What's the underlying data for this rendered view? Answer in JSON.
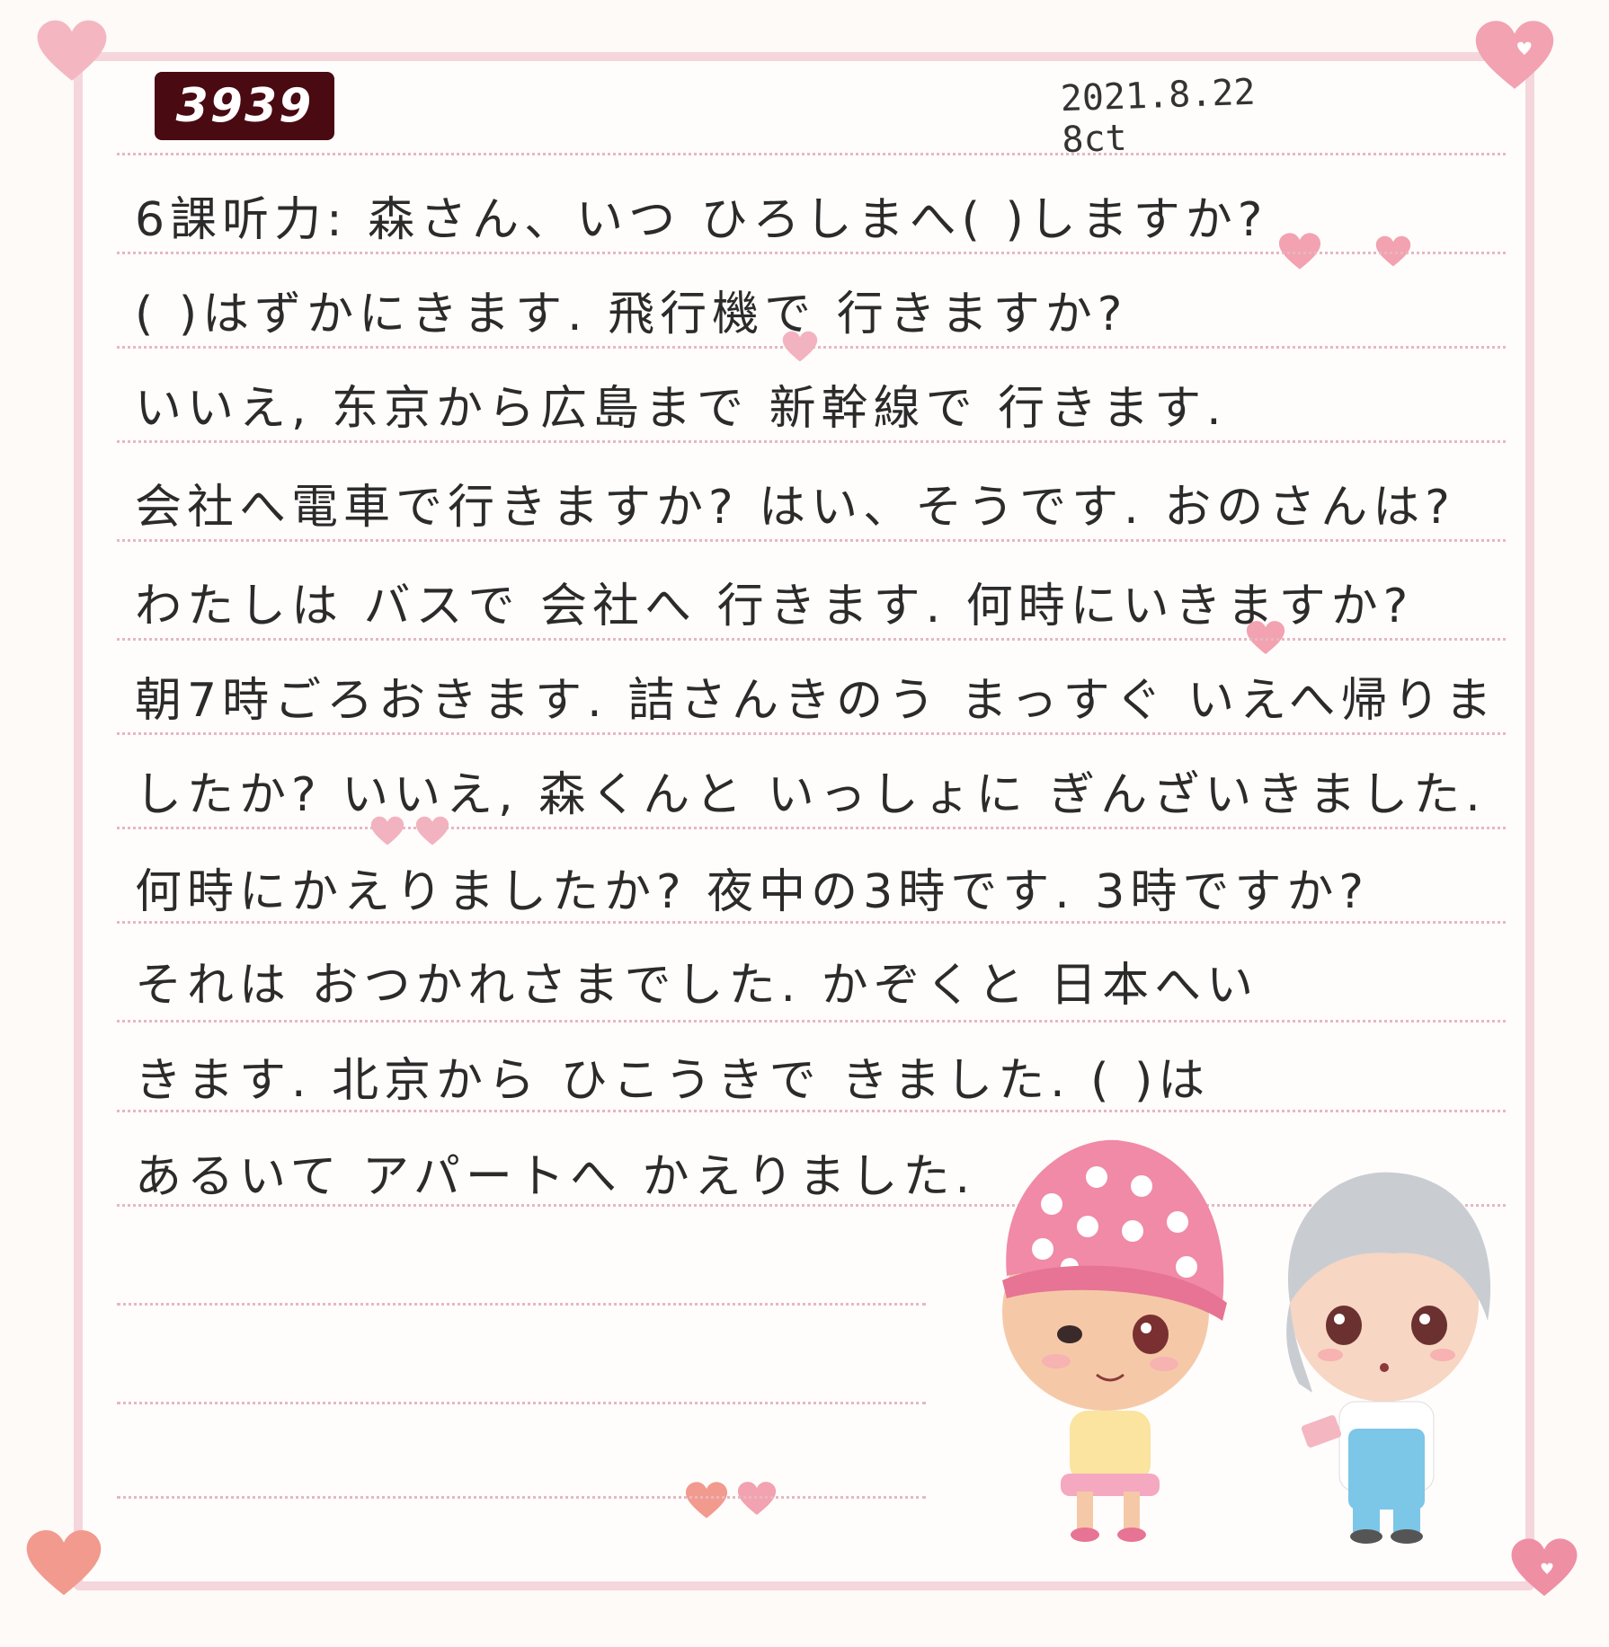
{
  "notebook": {
    "entry_number": "3939",
    "date": "2021.8.22 8ct"
  },
  "lines": [
    "6課听力: 森さん、いつ ひろしまへ(   )しますか?",
    "(   )はずかにきます. 飛行機で 行きますか?",
    "いいえ, 东京から広島まで 新幹線で 行きます.",
    "会社へ電車で行きますか? はい、そうです. おのさんは?",
    "わたしは バスで 会社へ 行きます. 何時にいきますか?",
    "朝7時ごろおきます. 詰さんきのう まっすぐ いえへ帰りま",
    "したか? いいえ, 森くんと いっしょに ぎんざいきました.",
    "何時にかえりましたか? 夜中の3時です. 3時ですか?",
    "それは おつかれさまでした. かぞくと 日本へい",
    "きます. 北京から ひこうきで きました. (  )は",
    "あるいて アパートへ かえりました."
  ],
  "colors": {
    "frame": "#f4d6dc",
    "badge": "#4a0a12",
    "heart": "#f2a2b0",
    "ink": "#2b2b2b"
  }
}
